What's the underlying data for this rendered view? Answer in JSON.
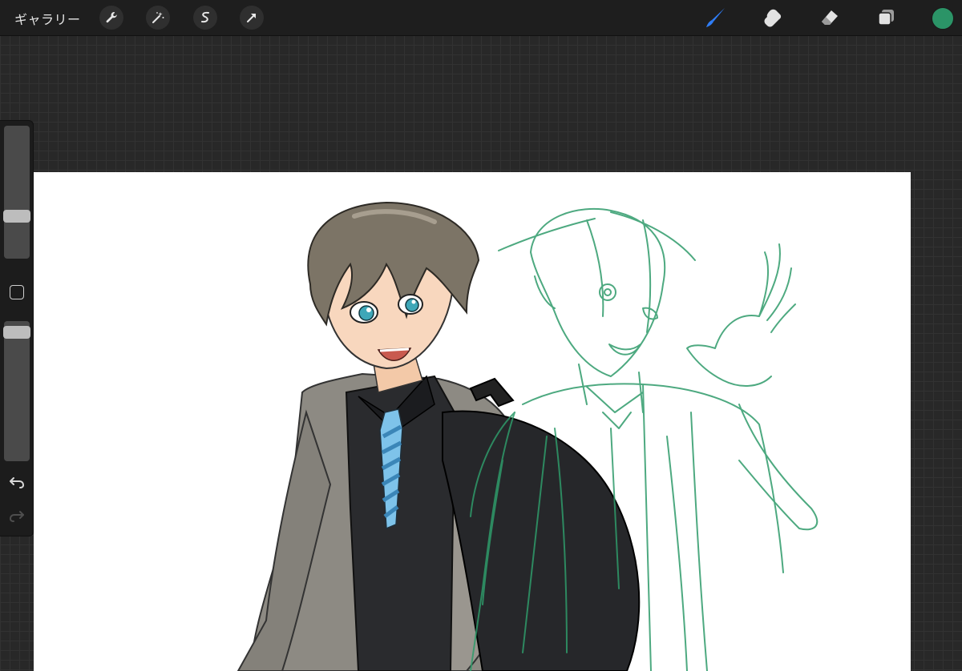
{
  "topbar": {
    "gallery_label": "ギャラリー",
    "left_tools": [
      "wrench-icon",
      "magic-wand-icon",
      "selection-icon",
      "transform-arrow-icon"
    ],
    "right_tools": [
      "brush-icon",
      "smudge-icon",
      "eraser-icon",
      "layers-icon"
    ],
    "active_tool": "brush-icon",
    "current_color": "#2b9467"
  },
  "sidebar": {
    "controls": [
      "brush-size-slider",
      "modify-button",
      "opacity-slider",
      "undo-icon",
      "redo-icon"
    ]
  },
  "canvas": {
    "background": "#ffffff",
    "artwork": "anime-boy-with-backpack-and-green-sketch"
  }
}
